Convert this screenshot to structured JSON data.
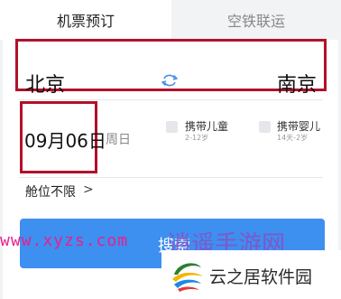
{
  "tabs": {
    "flight": "机票预订",
    "rail": "空铁联运"
  },
  "route": {
    "from": "北京",
    "to": "南京",
    "swap_icon": "swap-icon"
  },
  "date": {
    "value": "09月06日",
    "weekday": "周日"
  },
  "options": {
    "child_label": "携带儿童",
    "child_age": "2-12岁",
    "infant_label": "携带婴儿",
    "infant_age": "14天-2岁"
  },
  "cabin": {
    "label": "舱位不限",
    "chevron": ">"
  },
  "search": {
    "label": "搜索",
    "color": "#3d8ff0"
  },
  "watermarks": {
    "url": "www.xyzs.com",
    "site_name": "逍遥手游网",
    "brand": "云之居软件园"
  },
  "colors": {
    "highlight_border": "#b3102a",
    "accent": "#3d8ff0"
  }
}
